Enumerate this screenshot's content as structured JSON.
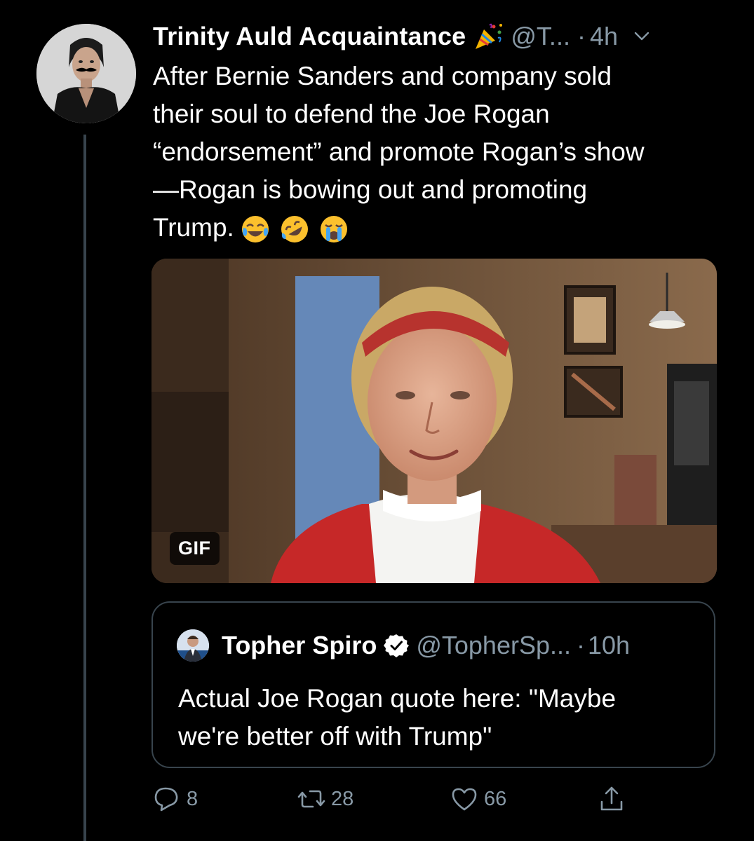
{
  "tweet": {
    "author": {
      "display_name": "Trinity Auld Acquaintance",
      "name_emoji": "party-popper-icon",
      "handle": "@T...",
      "separator": "·",
      "time": "4h"
    },
    "text_lines": [
      "After Bernie Sanders and company sold",
      "their soul to defend the Joe Rogan",
      "“endorsement” and promote Rogan’s show",
      "—Rogan is bowing out and promoting",
      "Trump."
    ],
    "text_emojis": [
      "face-with-tears-of-joy-icon",
      "rolling-on-floor-laughing-icon",
      "loudly-crying-face-icon"
    ],
    "media": {
      "badge": "GIF"
    },
    "quote": {
      "display_name": "Topher Spiro",
      "verified": true,
      "handle": "@TopherSp...",
      "separator": "·",
      "time": "10h",
      "text_lines": [
        "Actual Joe Rogan quote here: \"Maybe",
        "we're better off with Trump\""
      ]
    },
    "actions": {
      "reply_count": "8",
      "retweet_count": "28",
      "like_count": "66"
    }
  },
  "colors": {
    "background": "#000000",
    "primary_text": "#ffffff",
    "secondary_text": "#8899a6",
    "border": "#38444d"
  }
}
